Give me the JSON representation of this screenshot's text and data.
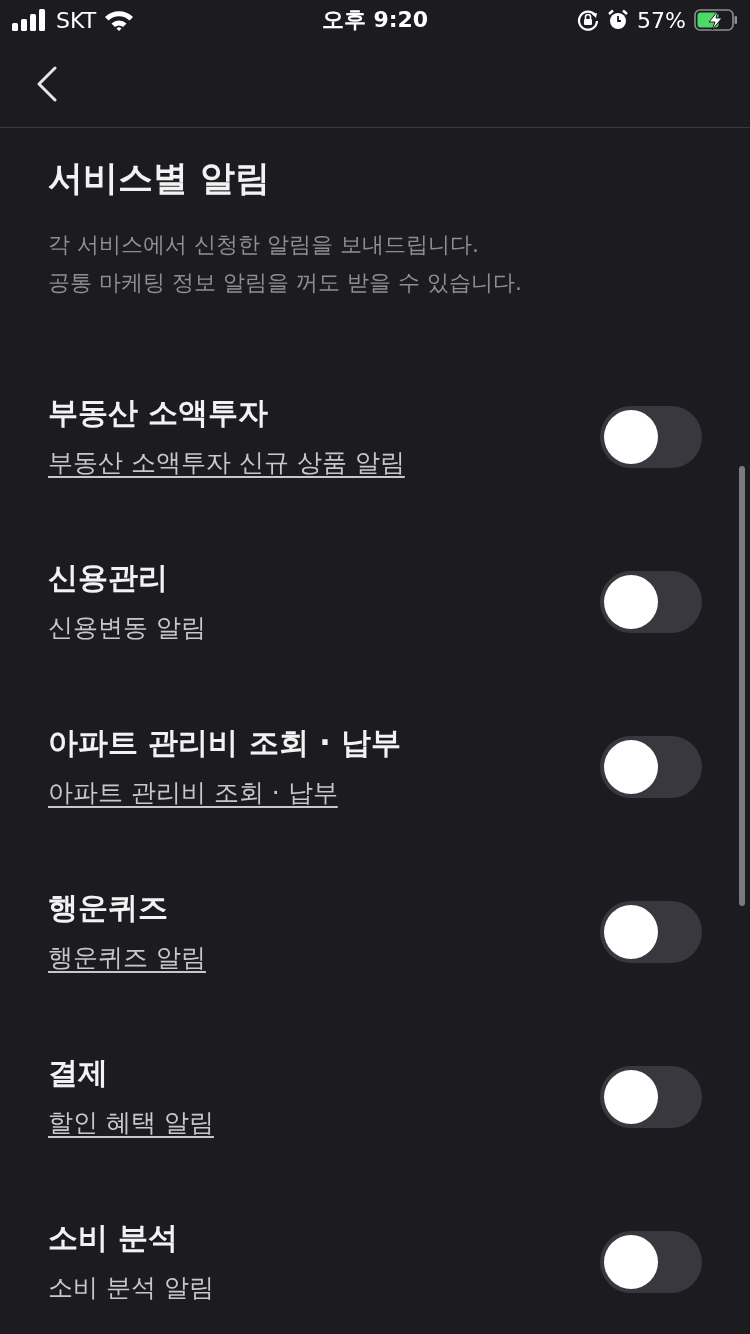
{
  "status_bar": {
    "carrier": "SKT",
    "time": "오후 9:20",
    "battery": "57%"
  },
  "header": {
    "title": "서비스별 알림",
    "description": [
      "각 서비스에서 신청한 알림을 보내드립니다.",
      "공통 마케팅 정보 알림을 꺼도 받을 수 있습니다."
    ]
  },
  "services": [
    {
      "name": "부동산 소액투자",
      "subtitle": "부동산 소액투자 신규 상품 알림",
      "linked": true,
      "on": false
    },
    {
      "name": "신용관리",
      "subtitle": "신용변동 알림",
      "linked": false,
      "on": false
    },
    {
      "name": "아파트 관리비 조회 · 납부",
      "subtitle": "아파트 관리비 조회 · 납부",
      "linked": true,
      "on": false
    },
    {
      "name": "행운퀴즈",
      "subtitle": "행운퀴즈 알림",
      "linked": true,
      "on": false
    },
    {
      "name": "결제",
      "subtitle": "할인 혜택 알림",
      "linked": true,
      "on": false
    },
    {
      "name": "소비 분석",
      "subtitle": "소비 분석 알림",
      "linked": false,
      "on": false
    }
  ]
}
